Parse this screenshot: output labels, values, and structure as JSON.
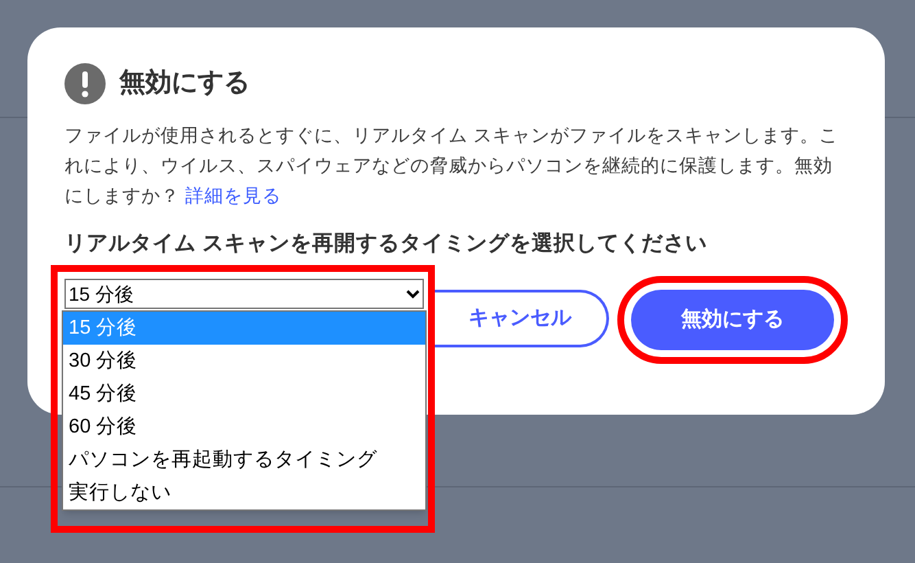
{
  "dialog": {
    "title": "無効にする",
    "description": "ファイルが使用されるとすぐに、リアルタイム スキャンがファイルをスキャンします。これにより、ウイルス、スパイウェアなどの脅威からパソコンを継続的に保護します。無効にしますか？",
    "link": "詳細を見る",
    "prompt": "リアルタイム スキャンを再開するタイミングを選択してください",
    "select": {
      "value": "15 分後",
      "expanded": true,
      "options": [
        {
          "label": "15 分後",
          "selected": true
        },
        {
          "label": "30 分後",
          "selected": false
        },
        {
          "label": "45 分後",
          "selected": false
        },
        {
          "label": "60 分後",
          "selected": false
        },
        {
          "label": "パソコンを再起動するタイミング",
          "selected": false
        },
        {
          "label": "実行しない",
          "selected": false
        }
      ]
    },
    "buttons": [
      {
        "label": "キャンセル",
        "kind": "secondary",
        "highlighted": false
      },
      {
        "label": "無効にする",
        "kind": "primary",
        "highlighted": true
      }
    ]
  }
}
